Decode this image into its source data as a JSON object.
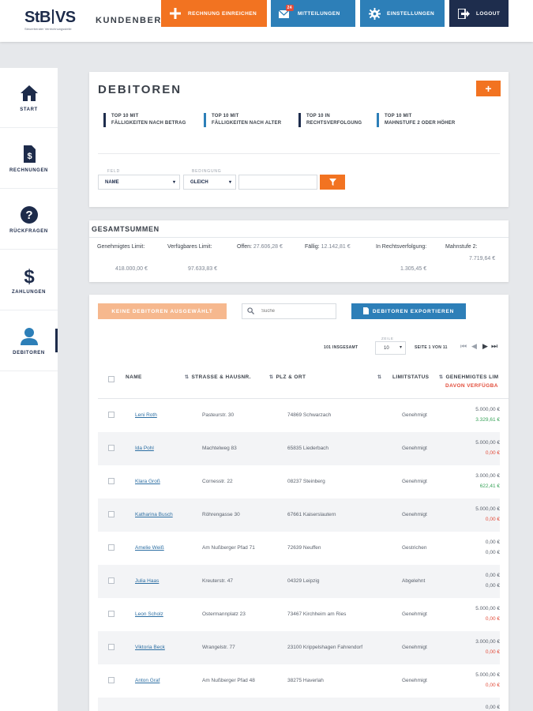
{
  "header": {
    "logo_text_left": "StB",
    "logo_text_right": "VS",
    "logo_subtitle": "Steuerberater Verrechnungsstelle",
    "portal_title": "KUNDENBERE",
    "buttons": {
      "submit_invoice": "Rechnung einreichen",
      "messages": "Mitteilungen",
      "messages_badge": "24",
      "settings": "Einstellungen",
      "logout": "Logout"
    },
    "colors": {
      "orange": "#f27321",
      "blue": "#2d7fb8",
      "navy": "#1e2d4d"
    }
  },
  "sidebar": {
    "items": [
      {
        "label": "Start",
        "icon": "home-icon"
      },
      {
        "label": "Rechnungen",
        "icon": "invoice-icon"
      },
      {
        "label": "Rückfragen",
        "icon": "question-icon"
      },
      {
        "label": "Zahlungen",
        "icon": "dollar-icon"
      },
      {
        "label": "Debitoren",
        "icon": "user-icon",
        "active": true
      }
    ]
  },
  "debitoren": {
    "title": "DEBITOREN",
    "add_label": "+",
    "quicklinks": [
      {
        "line1": "Top 10 mit",
        "line2": "Fälligkeiten nach Betrag"
      },
      {
        "line1": "Top 10 mit",
        "line2": "Fälligkeiten nach Alter"
      },
      {
        "line1": "Top 10 in",
        "line2": "Rechtsverfolgung"
      },
      {
        "line1": "Top 10 mit",
        "line2": "Mahnstufe 2 oder höher"
      }
    ],
    "filter": {
      "feld_label": "Feld",
      "feld_value": "Name",
      "bedingung_label": "Bedingung",
      "bedingung_value": "Gleich",
      "value": ""
    }
  },
  "gesamtsummen": {
    "title": "GESAMTSUMMEN",
    "genehmigtes_label": "Genehmigtes Limit:",
    "genehmigtes_value": "418.000,00 €",
    "verfuegbar_label": "Verfügbares Limit:",
    "verfuegbar_value": "97.633,83 €",
    "offen_label": "Offen:",
    "offen_value": "27.606,28 €",
    "faellig_label": "Fällig:",
    "faellig_value": "12.142,81 €",
    "rechts_label": "In Rechtsverfolgung:",
    "rechts_value": "1.305,45 €",
    "mahn_label": "Mahnstufe 2:",
    "mahn_value": "7.719,64 €"
  },
  "list": {
    "no_selection_button": "Keine Debitoren ausgewählt",
    "search_placeholder": "Suche",
    "export_button": "Debitoren exportieren",
    "total_text": "101 insgesamt",
    "rows_label": "Zeile",
    "rows_value": "10",
    "page_text": "Seite 1 von 11",
    "columns": {
      "name": "Name",
      "strasse": "Strasse & Hausnr.",
      "plz": "PLZ & Ort",
      "status": "Limitstatus",
      "limit": "Genehmigtes Lim",
      "available": "davon verfügba"
    },
    "rows": [
      {
        "name": "Leni Roth",
        "strasse": "Pasteurstr. 30",
        "plz": "74869 Schwarzach",
        "status": "Genehmigt",
        "limit": "5.000,00 €",
        "available": "3.329,61 €",
        "available_color": "green"
      },
      {
        "name": "Ida Pohl",
        "strasse": "Machtelweg 83",
        "plz": "65835 Liederbach",
        "status": "Genehmigt",
        "limit": "5.000,00 €",
        "available": "0,00 €",
        "available_color": "red"
      },
      {
        "name": "Klara Groß",
        "strasse": "Cornesstr. 22",
        "plz": "08237 Steinberg",
        "status": "Genehmigt",
        "limit": "3.000,00 €",
        "available": "622,41 €",
        "available_color": "green"
      },
      {
        "name": "Katharina Busch",
        "strasse": "Röhrengasse 30",
        "plz": "67661 Kaiserslautern",
        "status": "Genehmigt",
        "limit": "5.000,00 €",
        "available": "0,00 €",
        "available_color": "red"
      },
      {
        "name": "Amelie Weiß",
        "strasse": "Am Nußberger Pfad 71",
        "plz": "72639 Neuffen",
        "status": "Gestrichen",
        "limit": "0,00 €",
        "available": "0,00 €",
        "available_color": "grey"
      },
      {
        "name": "Julia Haas",
        "strasse": "Kreuterstr. 47",
        "plz": "04329 Leipzig",
        "status": "Abgelehnt",
        "limit": "0,00 €",
        "available": "0,00 €",
        "available_color": "grey"
      },
      {
        "name": "Leon Scholz",
        "strasse": "Ostermannplatz 23",
        "plz": "73467 Kirchheim am Ries",
        "status": "Genehmigt",
        "limit": "5.000,00 €",
        "available": "0,00 €",
        "available_color": "red"
      },
      {
        "name": "Viktoria Beck",
        "strasse": "Wrangelstr. 77",
        "plz": "23100 Krippelshagen Fahrendorf",
        "status": "Genehmigt",
        "limit": "3.000,00 €",
        "available": "0,00 €",
        "available_color": "red"
      },
      {
        "name": "Anton Graf",
        "strasse": "Am Nußberger Pfad 48",
        "plz": "38275 Haverlah",
        "status": "Genehmigt",
        "limit": "5.000,00 €",
        "available": "0,00 €",
        "available_color": "red"
      },
      {
        "name": "",
        "strasse": "",
        "plz": "",
        "status": "",
        "limit": "0,00 €",
        "available": "",
        "available_color": "grey"
      }
    ]
  }
}
